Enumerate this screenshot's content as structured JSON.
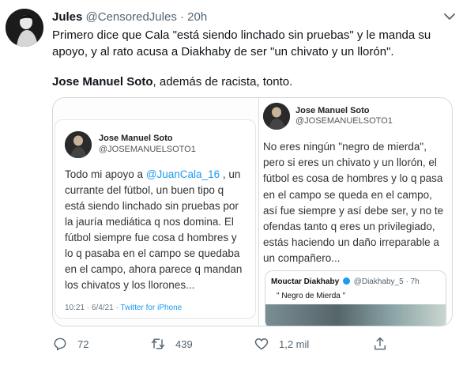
{
  "tweet": {
    "author_name": "Jules",
    "handle": "@CensoredJules",
    "separator": "·",
    "time": "20h",
    "text_line": "Primero dice que Cala \"está siendo linchado sin pruebas\" y le manda su apoyo, y al rato acusa a Diakhaby de ser \"un chivato y un llorón\".",
    "mention_bold": "Jose Manuel Soto",
    "text_rest": ", además de racista, tonto."
  },
  "screenshot_left": {
    "name": "Jose Manuel Soto",
    "handle": "@JOSEMANUELSOTO1",
    "body_start": "Todo mi apoyo a ",
    "body_mention": "@JuanCala_16",
    "body_rest": " , un currante del fútbol, un buen tipo q está siendo linchado sin pruebas por la jauría mediática q nos domina. El fútbol siempre fue cosa d hombres y lo q pasaba en el campo se quedaba en el campo, ahora parece q mandan los chivatos y los llorones...",
    "time": "10:21 · 6/4/21 · ",
    "source": "Twitter for iPhone"
  },
  "screenshot_right": {
    "name": "Jose Manuel Soto",
    "handle": "@JOSEMANUELSOTO1",
    "body": "No eres ningún \"negro de mierda\", pero si eres un chivato y un llorón, el fútbol es cosa de hombres y lo q pasa en el campo se queda en el campo, así fue siempre y así debe ser, y no te ofendas tanto q eres un privilegiado, estás haciendo un daño irreparable a un compañero...",
    "quoted": {
      "name": "Mouctar Diakhaby",
      "handle": "@Diakhaby_5 · 7h",
      "text": "\" Negro de Mierda \""
    }
  },
  "actions": {
    "replies": "72",
    "retweets": "439",
    "likes": "1,2 mil"
  },
  "colors": {
    "accent": "#1d9bf0",
    "muted": "#536471",
    "text": "#0f1419"
  }
}
